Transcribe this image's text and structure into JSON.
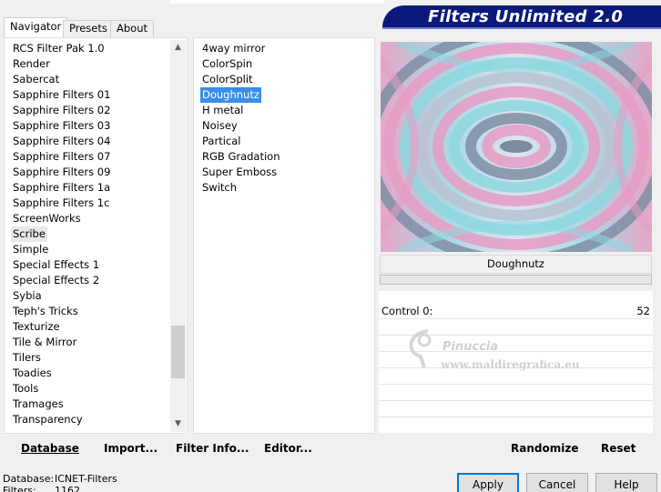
{
  "window": {
    "title": "Filters Unlimited 2.0"
  },
  "tabs": [
    {
      "label": "Navigator",
      "active": true
    },
    {
      "label": "Presets",
      "active": false
    },
    {
      "label": "About",
      "active": false
    }
  ],
  "categories": {
    "items": [
      "RCS Filter Pak 1.0",
      "Render",
      "Sabercat",
      "Sapphire Filters 01",
      "Sapphire Filters 02",
      "Sapphire Filters 03",
      "Sapphire Filters 04",
      "Sapphire Filters 07",
      "Sapphire Filters 09",
      "Sapphire Filters 1a",
      "Sapphire Filters 1c",
      "ScreenWorks",
      "Scribe",
      "Simple",
      "Special Effects 1",
      "Special Effects 2",
      "Sybia",
      "Teph's Tricks",
      "Texturize",
      "Tile & Mirror",
      "Tilers",
      "Toadies",
      "Tools",
      "Tramages",
      "Transparency"
    ],
    "selected": "Scribe"
  },
  "filters": {
    "items": [
      "4way mirror",
      "ColorSpin",
      "ColorSplit",
      "Doughnutz",
      "H metal",
      "Noisey",
      "Partical",
      "RGB Gradation",
      "Super Emboss",
      "Switch"
    ],
    "selected": "Doughnutz"
  },
  "left_buttons": {
    "database": "Database",
    "import": "Import...",
    "filter_info": "Filter Info...",
    "editor": "Editor..."
  },
  "preview": {
    "filter_name": "Doughnutz"
  },
  "controls": [
    {
      "label": "Control 0:",
      "value": "52"
    }
  ],
  "right_buttons": {
    "randomize": "Randomize",
    "reset": "Reset"
  },
  "watermark": {
    "name": "Pinuccia",
    "url": "www.maldiregrafica.eu"
  },
  "footer": {
    "database_label": "Database:",
    "database_value": "ICNET-Filters",
    "filters_label": "Filters:",
    "filters_value": "1162"
  },
  "dialog_buttons": {
    "apply": "Apply",
    "cancel": "Cancel",
    "help": "Help"
  },
  "colors": {
    "banner": "#0b1a7a",
    "selection": "#3a8ee6",
    "preview_pink": "#e79cc5",
    "preview_teal": "#8ed8e0",
    "preview_slate": "#7f8fa6"
  }
}
